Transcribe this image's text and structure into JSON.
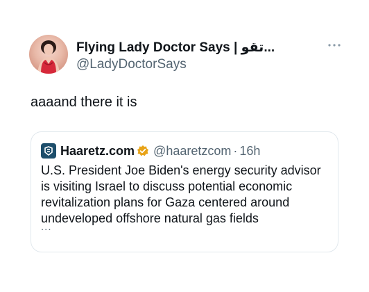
{
  "tweet": {
    "author": {
      "display_name": "Flying Lady Doctor Says | تقو...",
      "handle": "@LadyDoctorSays"
    },
    "text": "aaaand there it is",
    "more_icon": "more-horizontal-icon"
  },
  "quoted": {
    "name": "Haaretz.com",
    "handle": "@haaretzcom",
    "separator": "·",
    "time": "16h",
    "text": "U.S. President Joe Biden's energy security advisor is visiting Israel to discuss potential economic revitalization plans for Gaza centered around undeveloped offshore natural gas fields",
    "ellipsis": "...",
    "logo_icon": "haaretz-logo-icon",
    "badge_icon": "verified-badge-icon",
    "badge_color": "#e8a317"
  },
  "colors": {
    "text_primary": "#0f1419",
    "text_secondary": "#536471",
    "border": "#e1e8ed"
  }
}
